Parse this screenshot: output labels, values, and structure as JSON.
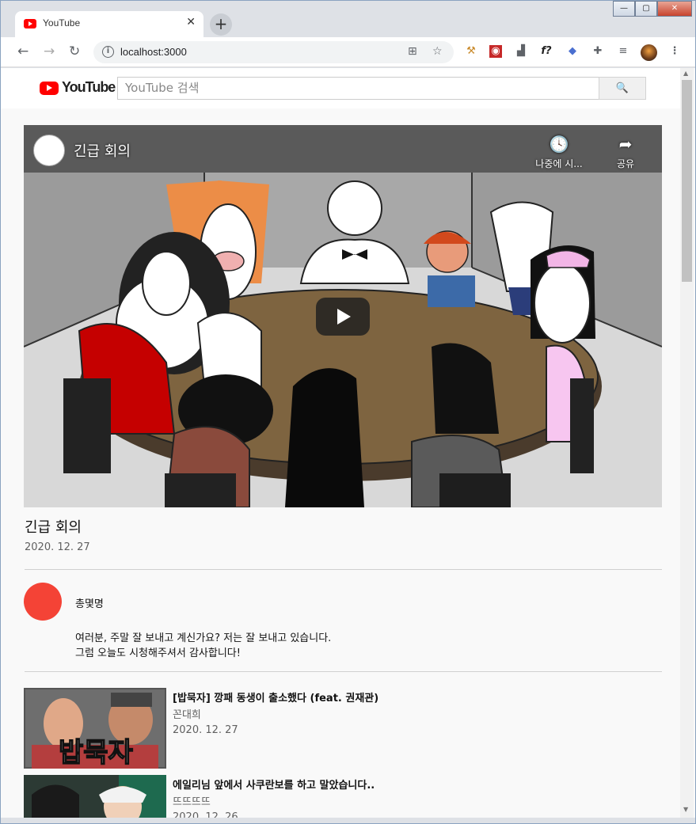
{
  "browser": {
    "tab_title": "YouTube",
    "tab_close": "✕",
    "new_tab": "+",
    "url": "localhost:3000",
    "win_min": "—",
    "win_max": "▢",
    "win_close": "✕"
  },
  "header": {
    "logo_text": "YouTube",
    "search_placeholder": "YouTube 검색",
    "search_button": "🔍"
  },
  "player": {
    "title": "긴급 회의",
    "watch_later_label": "나중에 시...",
    "share_label": "공유"
  },
  "video": {
    "title": "긴급 회의",
    "date": "2020. 12. 27",
    "owner": "총몇명",
    "description_line1": "여러분, 주말 잘 보내고 계신가요? 저는 잘 보내고 있습니다.",
    "description_line2": "그럼 오늘도 시청해주셔서 감사합니다!"
  },
  "related": [
    {
      "title": "[밥묵자] 깡패 동생이 출소했다 (feat. 권재관)",
      "channel": "꼰대희",
      "date": "2020. 12. 27",
      "thumb_text": "밥묵자"
    },
    {
      "title": "에일리님 앞에서 사쿠란보를 하고 말았습니다..",
      "channel": "뜨뜨뜨뜨",
      "date": "2020. 12. 26"
    }
  ]
}
